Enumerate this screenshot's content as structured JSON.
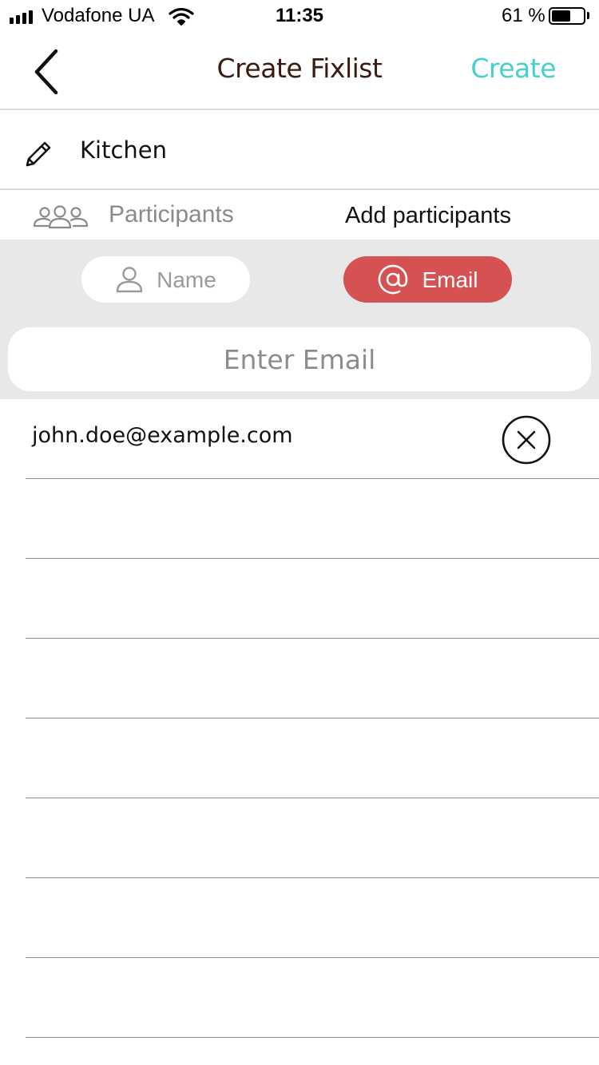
{
  "status_bar": {
    "carrier": "Vodafone UA",
    "time": "11:35",
    "battery_percent": "61 %",
    "battery_level": 0.61
  },
  "nav": {
    "title": "Create Fixlist",
    "action_label": "Create",
    "action_color": "#45cfcf"
  },
  "fixlist": {
    "name": "Kitchen"
  },
  "participants": {
    "label": "Participants",
    "add_label": "Add participants"
  },
  "mode_toggle": {
    "name_label": "Name",
    "email_label": "Email",
    "selected": "Email",
    "accent_color": "#d65151"
  },
  "email_input": {
    "placeholder": "Enter Email",
    "value": ""
  },
  "emails": [
    "john.doe@example.com",
    "",
    "",
    "",
    "",
    "",
    "",
    "",
    ""
  ],
  "icons": {
    "back": "chevron-left-icon",
    "pencil": "pencil-icon",
    "participants": "group-icon",
    "name": "person-icon",
    "email": "at-sign-icon",
    "remove": "close-circle-icon"
  }
}
